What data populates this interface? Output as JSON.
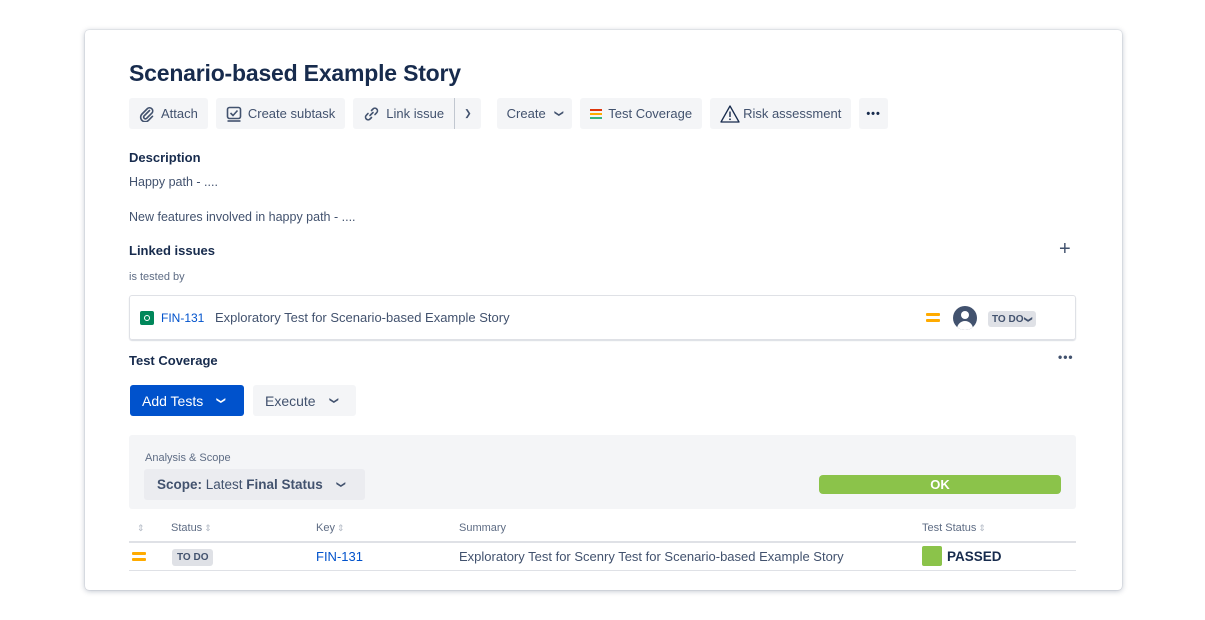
{
  "issue": {
    "title": "Scenario-based Example Story"
  },
  "toolbar": {
    "attach": "Attach",
    "create_subtask": "Create subtask",
    "link_issue": "Link issue",
    "create": "Create",
    "test_coverage": "Test Coverage",
    "risk_assessment": "Risk assessment",
    "more": "•••"
  },
  "description": {
    "heading": "Description",
    "line1": "Happy path - ....",
    "line2": "New features involved in happy path - ...."
  },
  "linked_issues": {
    "heading": "Linked issues",
    "add": "+",
    "relation": "is tested by",
    "items": [
      {
        "key": "FIN-131",
        "summary": "Exploratory Test for Scenario-based Example Story",
        "status": "TO DO",
        "priority_color": "#ffab00",
        "type_color": "#00875a"
      }
    ]
  },
  "test_coverage": {
    "heading": "Test Coverage",
    "more": "•••",
    "add_tests": "Add Tests",
    "execute": "Execute",
    "analysis_label": "Analysis & Scope",
    "scope_prefix": "Scope:",
    "scope_mid": " Latest ",
    "scope_value": "Final Status",
    "overall_status": "OK",
    "ok_color": "#8bc34a",
    "columns": [
      "Status",
      "Key",
      "Summary",
      "Test Status"
    ],
    "rows": [
      {
        "status": "TO DO",
        "key": "FIN-131",
        "summary": "Exploratory Test for Scenry Test for Scenario-based Example Story",
        "test_status": "PASSED",
        "test_status_color": "#8bc34a"
      }
    ]
  }
}
